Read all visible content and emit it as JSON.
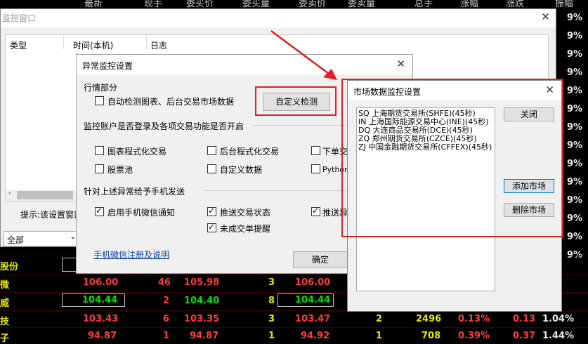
{
  "bg_table": {
    "header": [
      "最新",
      "现手",
      "委买价",
      "委买量",
      "委卖价",
      "委卖量",
      "总手",
      "涨幅",
      "涨跌",
      "振幅"
    ],
    "right_col": [
      "9%",
      "9%",
      "9%",
      "9%",
      "9%",
      "9%",
      "9%",
      "9%",
      "9%",
      "9%",
      "9%",
      "9%",
      "9%",
      "9%"
    ],
    "rows": [
      {
        "name": "股份",
        "c1": "",
        "c2": "",
        "c3": "",
        "c4": "",
        "c5": "",
        "c6": ""
      },
      {
        "name": "微",
        "c1": "106.00",
        "c2": "46",
        "c3": "105.98",
        "c4": "3",
        "c5": "106.00",
        "c6": "1"
      },
      {
        "name": "威",
        "c1": "104.44",
        "c2": "2",
        "c3": "104.40",
        "c4": "8",
        "c5": "104.44",
        "c6": "1"
      },
      {
        "name": "技",
        "c1": "103.43",
        "c2": "6",
        "c3": "103.35",
        "c4": "3",
        "c5": "103.47",
        "c6": "2",
        "total": "2496",
        "pct": "0.13%",
        "chg": "0.13",
        "amp": "1.04%"
      },
      {
        "name": "子",
        "c1": "94.87",
        "c2": "1",
        "c3": "94.87",
        "c4": "1",
        "c5": "94.92",
        "c6": "1",
        "total": "708",
        "pct": "0.39%",
        "chg": "0.37",
        "amp": "1.44%"
      }
    ]
  },
  "monitor_window": {
    "title": "监控窗口",
    "columns": [
      "类型",
      "时间(本机)",
      "日志"
    ],
    "hint": "提示:该设置窗口",
    "select_value": "全部"
  },
  "settings_dialog": {
    "title": "异常监控设置",
    "section1": "行情部分",
    "auto_detect": "自动检测图表、后台交易市场数据",
    "custom_detect_button": "自定义检测",
    "section2": "监控账户是否登录及各项交易功能是否开启",
    "options": [
      "图表程式化交易",
      "后台程式化交易",
      "下单交易",
      "股票池",
      "自定义数据",
      "Python运行"
    ],
    "section3": "针对上述异常给予手机发送",
    "notify_options": [
      "启用手机微信通知",
      "推送交易状态",
      "推送异常",
      "未成交单提醒"
    ],
    "link": "手机微信注册及说明",
    "ok_button": "确定"
  },
  "market_dialog": {
    "title": "市场数据监控设置",
    "markets": [
      "SQ 上海期货交易所(SHFE)(45秒)",
      "IN 上海国际能源交易中心(INE)(45秒)",
      "DQ 大连商品交易所(DCE)(45秒)",
      "ZQ 郑州期货交易所(CZCE)(45秒)",
      "ZJ 中国金融期货交易所(CFFEX)(45秒)"
    ],
    "close_button": "关闭",
    "add_button": "添加市场",
    "delete_button": "删除市场"
  },
  "colors": {
    "annotation_red": "#e02020"
  }
}
